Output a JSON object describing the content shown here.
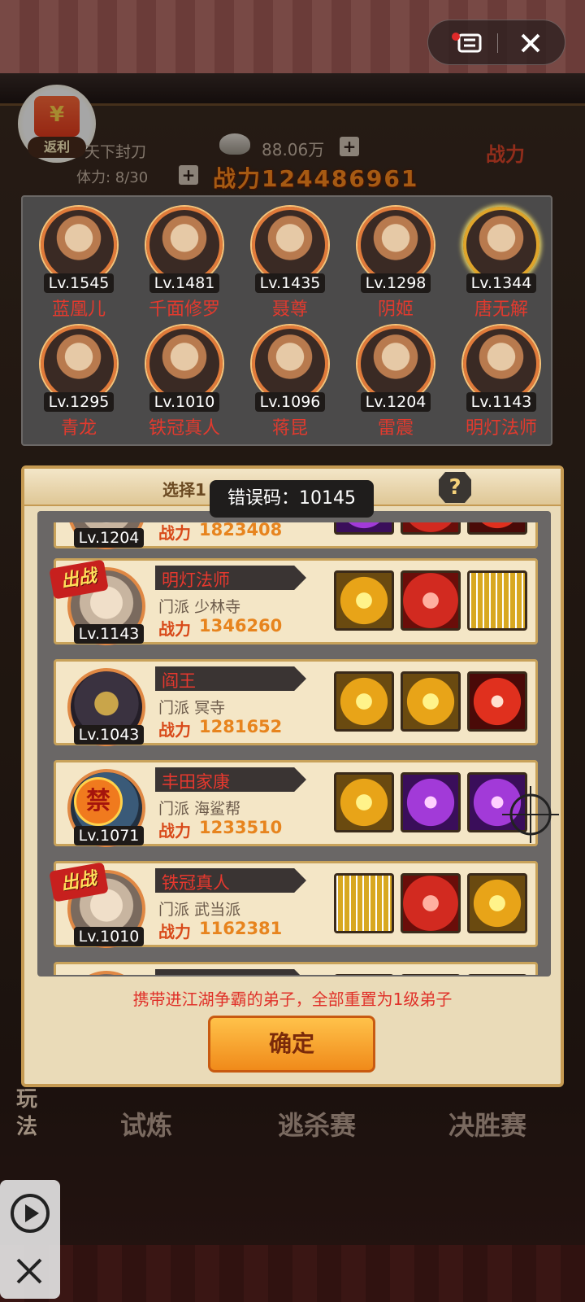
{
  "header": {
    "rebate_label": "返利",
    "title_name": "天下封刀",
    "stamina": "体力: 8/30",
    "silver": "88.06万",
    "power": "战力124486961",
    "right_badge": "战力"
  },
  "team": [
    {
      "lv": "Lv.1545",
      "name": "蓝凰儿"
    },
    {
      "lv": "Lv.1481",
      "name": "千面修罗"
    },
    {
      "lv": "Lv.1435",
      "name": "聂尊"
    },
    {
      "lv": "Lv.1298",
      "name": "阴姬"
    },
    {
      "lv": "Lv.1344",
      "name": "唐无解"
    },
    {
      "lv": "Lv.1295",
      "name": "青龙"
    },
    {
      "lv": "Lv.1010",
      "name": "铁冠真人"
    },
    {
      "lv": "Lv.1096",
      "name": "蒋昆"
    },
    {
      "lv": "Lv.1204",
      "name": "雷震"
    },
    {
      "lv": "Lv.1143",
      "name": "明灯法师"
    }
  ],
  "dialog": {
    "title": "选择1          的弟子",
    "help": "?",
    "toast": "错误码：10145",
    "warning": "携带进江湖争霸的弟子，全部重置为1级弟子",
    "confirm": "确定",
    "sect_label": "门派",
    "power_label": "战力",
    "fight_tag": "出战",
    "ban_tag": "禁"
  },
  "disciples": [
    {
      "lv": "Lv.1204",
      "name": "",
      "sect": "",
      "power": "1823408",
      "tag": ""
    },
    {
      "lv": "Lv.1143",
      "name": "明灯法师",
      "sect": "少林寺",
      "power": "1346260",
      "tag": "fight"
    },
    {
      "lv": "Lv.1043",
      "name": "阎王",
      "sect": "冥寺",
      "power": "1281652",
      "tag": ""
    },
    {
      "lv": "Lv.1071",
      "name": "丰田家康",
      "sect": "海鲨帮",
      "power": "1233510",
      "tag": "ban"
    },
    {
      "lv": "Lv.1010",
      "name": "铁冠真人",
      "sect": "武当派",
      "power": "1162381",
      "tag": "fight"
    }
  ],
  "bottom": {
    "side": "玩法",
    "tabs": [
      "试炼",
      "逃杀赛",
      "决胜赛"
    ]
  },
  "colors": {
    "accent": "#e7841e",
    "name_red": "#e23a2e"
  }
}
